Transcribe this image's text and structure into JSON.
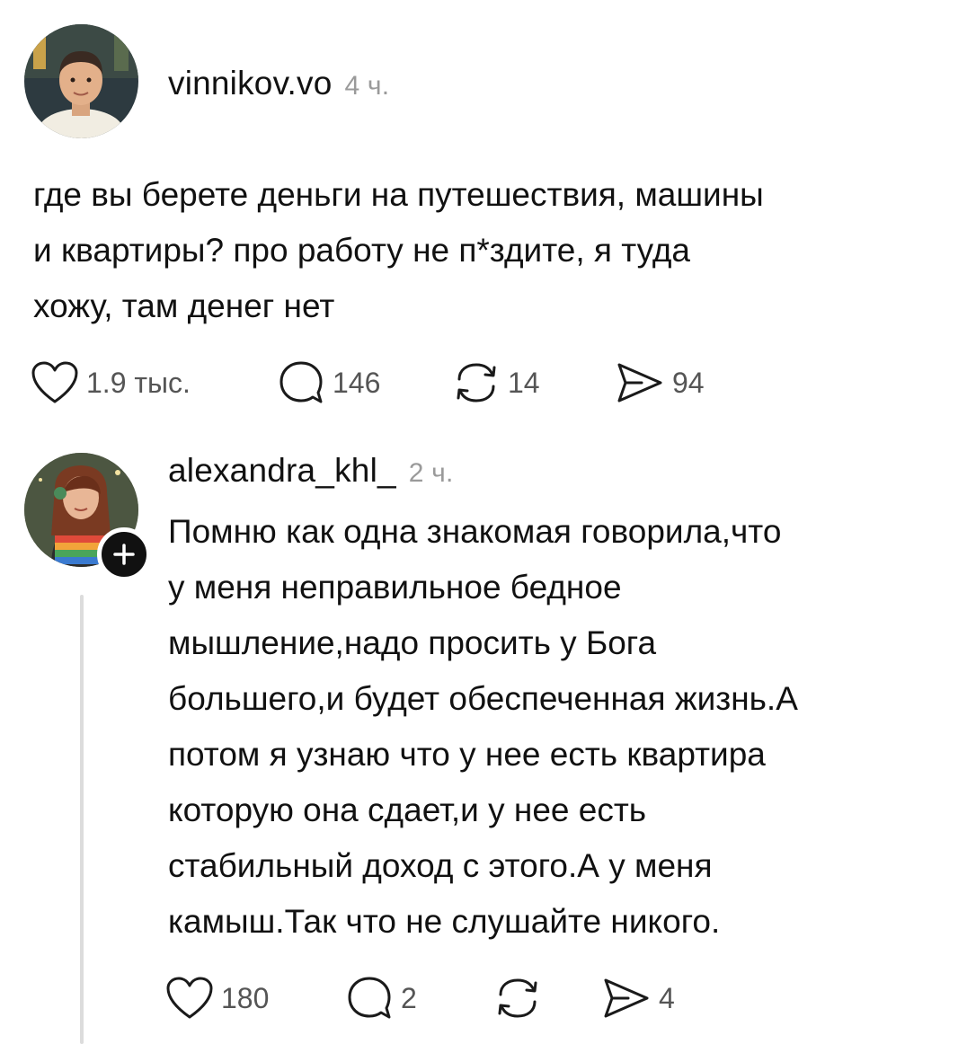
{
  "post": {
    "username": "vinnikov.vo",
    "time": "4 ч.",
    "text": "где вы берете деньги на путешествия, машины\nи квартиры? про работу не п*здите, я туда\nхожу, там денег нет",
    "likes": "1.9 тыс.",
    "comments": "146",
    "reposts": "14",
    "shares": "94"
  },
  "reply": {
    "username": "alexandra_khl_",
    "time": "2 ч.",
    "text": "Помню как одна знакомая говорила,что\nу меня неправильное бедное\nмышление,надо просить у Бога\nбольшего,и будет обеспеченная жизнь.А\nпотом я узнаю что у нее есть квартира\nкоторую она сдает,и у нее есть\nстабильный доход с этого.А у меня\nкамыш.Так что не слушайте никого.",
    "likes": "180",
    "comments": "2",
    "reposts": "",
    "shares": "4"
  },
  "icons": {
    "like": "heart-icon",
    "comment": "speech-bubble-icon",
    "repost": "repost-icon",
    "share": "send-icon",
    "follow": "plus-icon"
  }
}
